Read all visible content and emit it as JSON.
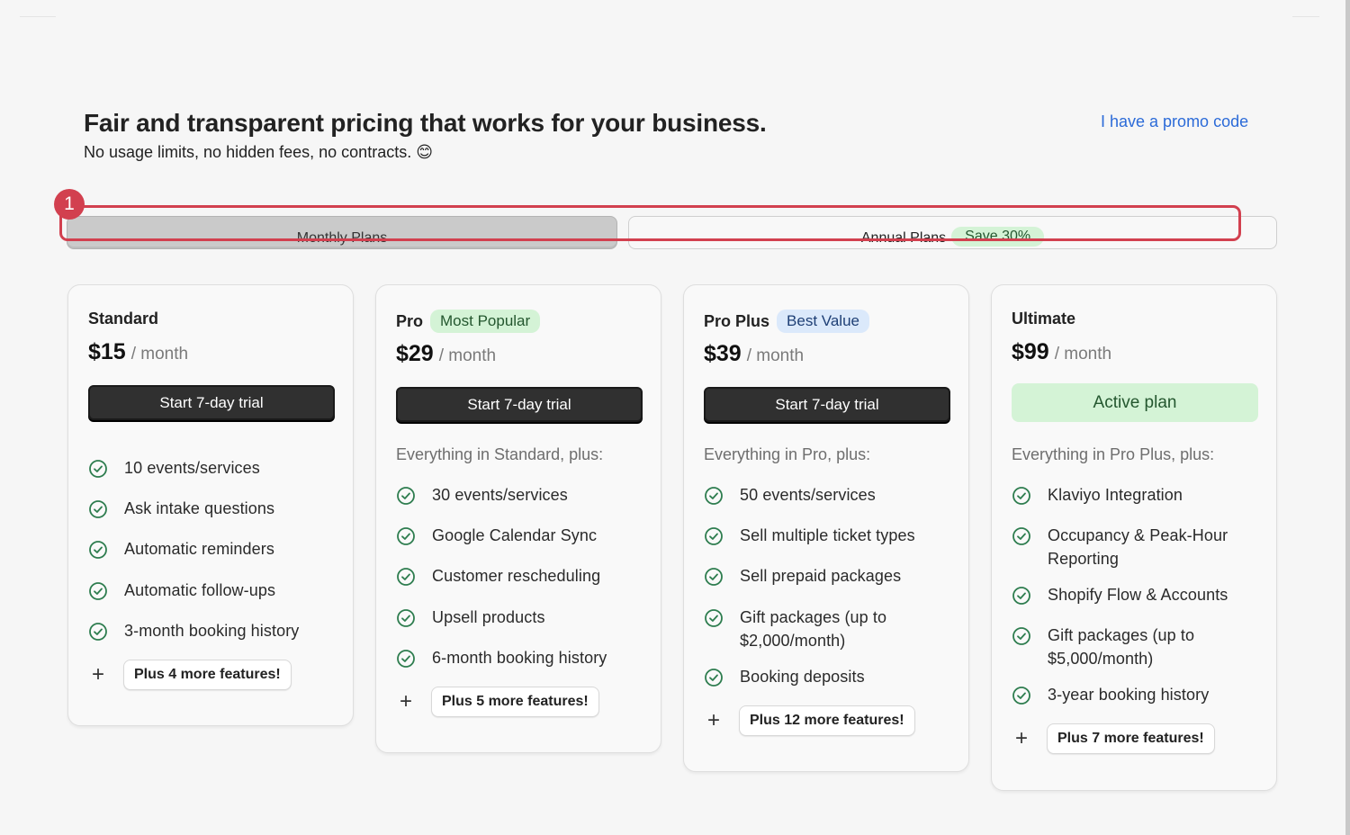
{
  "header": {
    "title": "Fair and transparent pricing that works for your business.",
    "subtitle": "No usage limits, no hidden fees, no contracts. 😊",
    "promo_link": "I have a promo code"
  },
  "billing_toggle": {
    "monthly_label": "Monthly Plans",
    "annual_label": "Annual Plans",
    "annual_badge": "Save 30%",
    "selected": "monthly"
  },
  "annotation": {
    "marker_label": "1"
  },
  "plans": [
    {
      "name": "Standard",
      "badge": "",
      "price": "$15",
      "period": "/ month",
      "cta": "Start 7-day trial",
      "intro": "",
      "features": [
        "10 events/services",
        "Ask intake questions",
        "Automatic reminders",
        "Automatic follow-ups",
        "3-month booking history"
      ],
      "more": "Plus 4 more features!"
    },
    {
      "name": "Pro",
      "badge": "Most Popular",
      "price": "$29",
      "period": "/ month",
      "cta": "Start 7-day trial",
      "intro": "Everything in Standard, plus:",
      "features": [
        "30 events/services",
        "Google Calendar Sync",
        "Customer rescheduling",
        "Upsell products",
        "6-month booking history"
      ],
      "more": "Plus 5 more features!"
    },
    {
      "name": "Pro Plus",
      "badge": "Best Value",
      "price": "$39",
      "period": "/ month",
      "cta": "Start 7-day trial",
      "intro": "Everything in Pro, plus:",
      "features": [
        "50 events/services",
        "Sell multiple ticket types",
        "Sell prepaid packages",
        "Gift packages (up to $2,000/month)",
        "Booking deposits"
      ],
      "more": "Plus 12 more features!"
    },
    {
      "name": "Ultimate",
      "badge": "",
      "price": "$99",
      "period": "/ month",
      "cta": "Active plan",
      "intro": "Everything in Pro Plus, plus:",
      "features": [
        "Klaviyo Integration",
        "Occupancy & Peak-Hour Reporting",
        "Shopify Flow & Accounts",
        "Gift packages (up to $5,000/month)",
        "3-year booking history"
      ],
      "more": "Plus 7 more features!"
    }
  ],
  "colors": {
    "accent_link": "#2c6bd8",
    "check_green": "#2e7d4f",
    "badge_green_bg": "#d4f3d6",
    "badge_blue_bg": "#dbe9fb",
    "annotation_red": "#d2404f",
    "cta_dark": "#303030"
  }
}
